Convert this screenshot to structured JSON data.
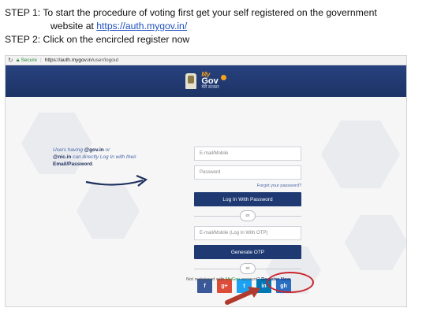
{
  "instructions": {
    "step1_prefix": "STEP 1: To start the procedure of voting  first get your self registered on the government",
    "step1_cont": "website at ",
    "step1_link": "https://auth.mygov.in/",
    "step2": "STEP 2: Click on the encircled register now"
  },
  "browser": {
    "secure_label": "Secure",
    "url_domain": "https://auth.mygov.in",
    "url_path": "/user/logout"
  },
  "header": {
    "logo_my": "My",
    "logo_gov": "Gov",
    "logo_hindi": "मेरी सरकार"
  },
  "note": {
    "line_prefix": "Users having ",
    "gov_domain": "@gov.in",
    "or_text": " or",
    "nic_domain": "@nic.in",
    "line_rest": " can directly Log In with their ",
    "credentials": "Email/Password",
    "period": "."
  },
  "form": {
    "email_placeholder": "E-mail/Mobile",
    "password_placeholder": "Password",
    "forgot_label": "Forgot your password?",
    "login_button": "Log In With Password",
    "or_label": "or",
    "otp_placeholder": "E-mail/Mobile (Log In With OTP)",
    "otp_button": "Generate OTP",
    "or_label_2": "or"
  },
  "socials": [
    {
      "label": "f",
      "icon": "facebook-icon",
      "color": "#3b5998"
    },
    {
      "label": "g+",
      "icon": "google-plus-icon",
      "color": "#dd4b39"
    },
    {
      "label": "t",
      "icon": "twitter-icon",
      "color": "#1da1f2"
    },
    {
      "label": "in",
      "icon": "linkedin-icon",
      "color": "#0077b5"
    },
    {
      "label": "gh",
      "icon": "github-icon",
      "color": "#2a6ec2"
    }
  ],
  "register": {
    "prefix": "Not registered with ",
    "brand": "MyGov",
    "suffix": " account? ",
    "link": "Register Now"
  },
  "colors": {
    "header_blue": "#1f3a73",
    "annotation_red": "#c9252d",
    "arrow_navy": "#1d2f5e"
  }
}
